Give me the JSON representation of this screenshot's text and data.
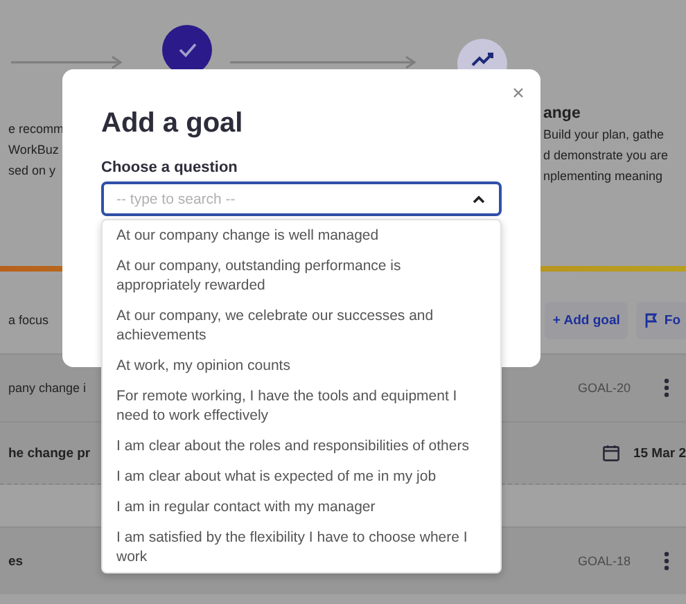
{
  "background": {
    "steps": [
      {
        "completed": true
      },
      {
        "completed": false
      }
    ],
    "left_lines": [
      "e recomm",
      "WorkBuz",
      "sed on y"
    ],
    "right_step": {
      "title": "ange",
      "lines": [
        "Build your plan, gathe",
        "d demonstrate you are",
        "nplementing meaning"
      ]
    },
    "focus_label": "a focus",
    "add_goal_button": "+ Add goal",
    "focus_button": "Fo",
    "rows": [
      {
        "kind": "goal",
        "description": "pany change i",
        "code": "GOAL-20"
      },
      {
        "kind": "action",
        "title": "he change pr",
        "date": "15 Mar 2"
      },
      {
        "kind": "goal",
        "title": "es",
        "code": "GOAL-18"
      }
    ]
  },
  "modal": {
    "title": "Add a goal",
    "field_label": "Choose a question",
    "placeholder": "-- type to search --",
    "expanded": true,
    "options": [
      "At our company change is well managed",
      "At our company, outstanding performance is appropriately rewarded",
      "At our company, we celebrate our successes and achievements",
      "At work, my opinion counts",
      "For remote working, I have the tools and equipment I need to work effectively",
      "I am clear about the roles and responsibilities of others",
      "I am clear about what is expected of me in my job",
      "I am in regular contact with my manager",
      "I am satisfied by the flexibility I have to choose where I work"
    ]
  }
}
